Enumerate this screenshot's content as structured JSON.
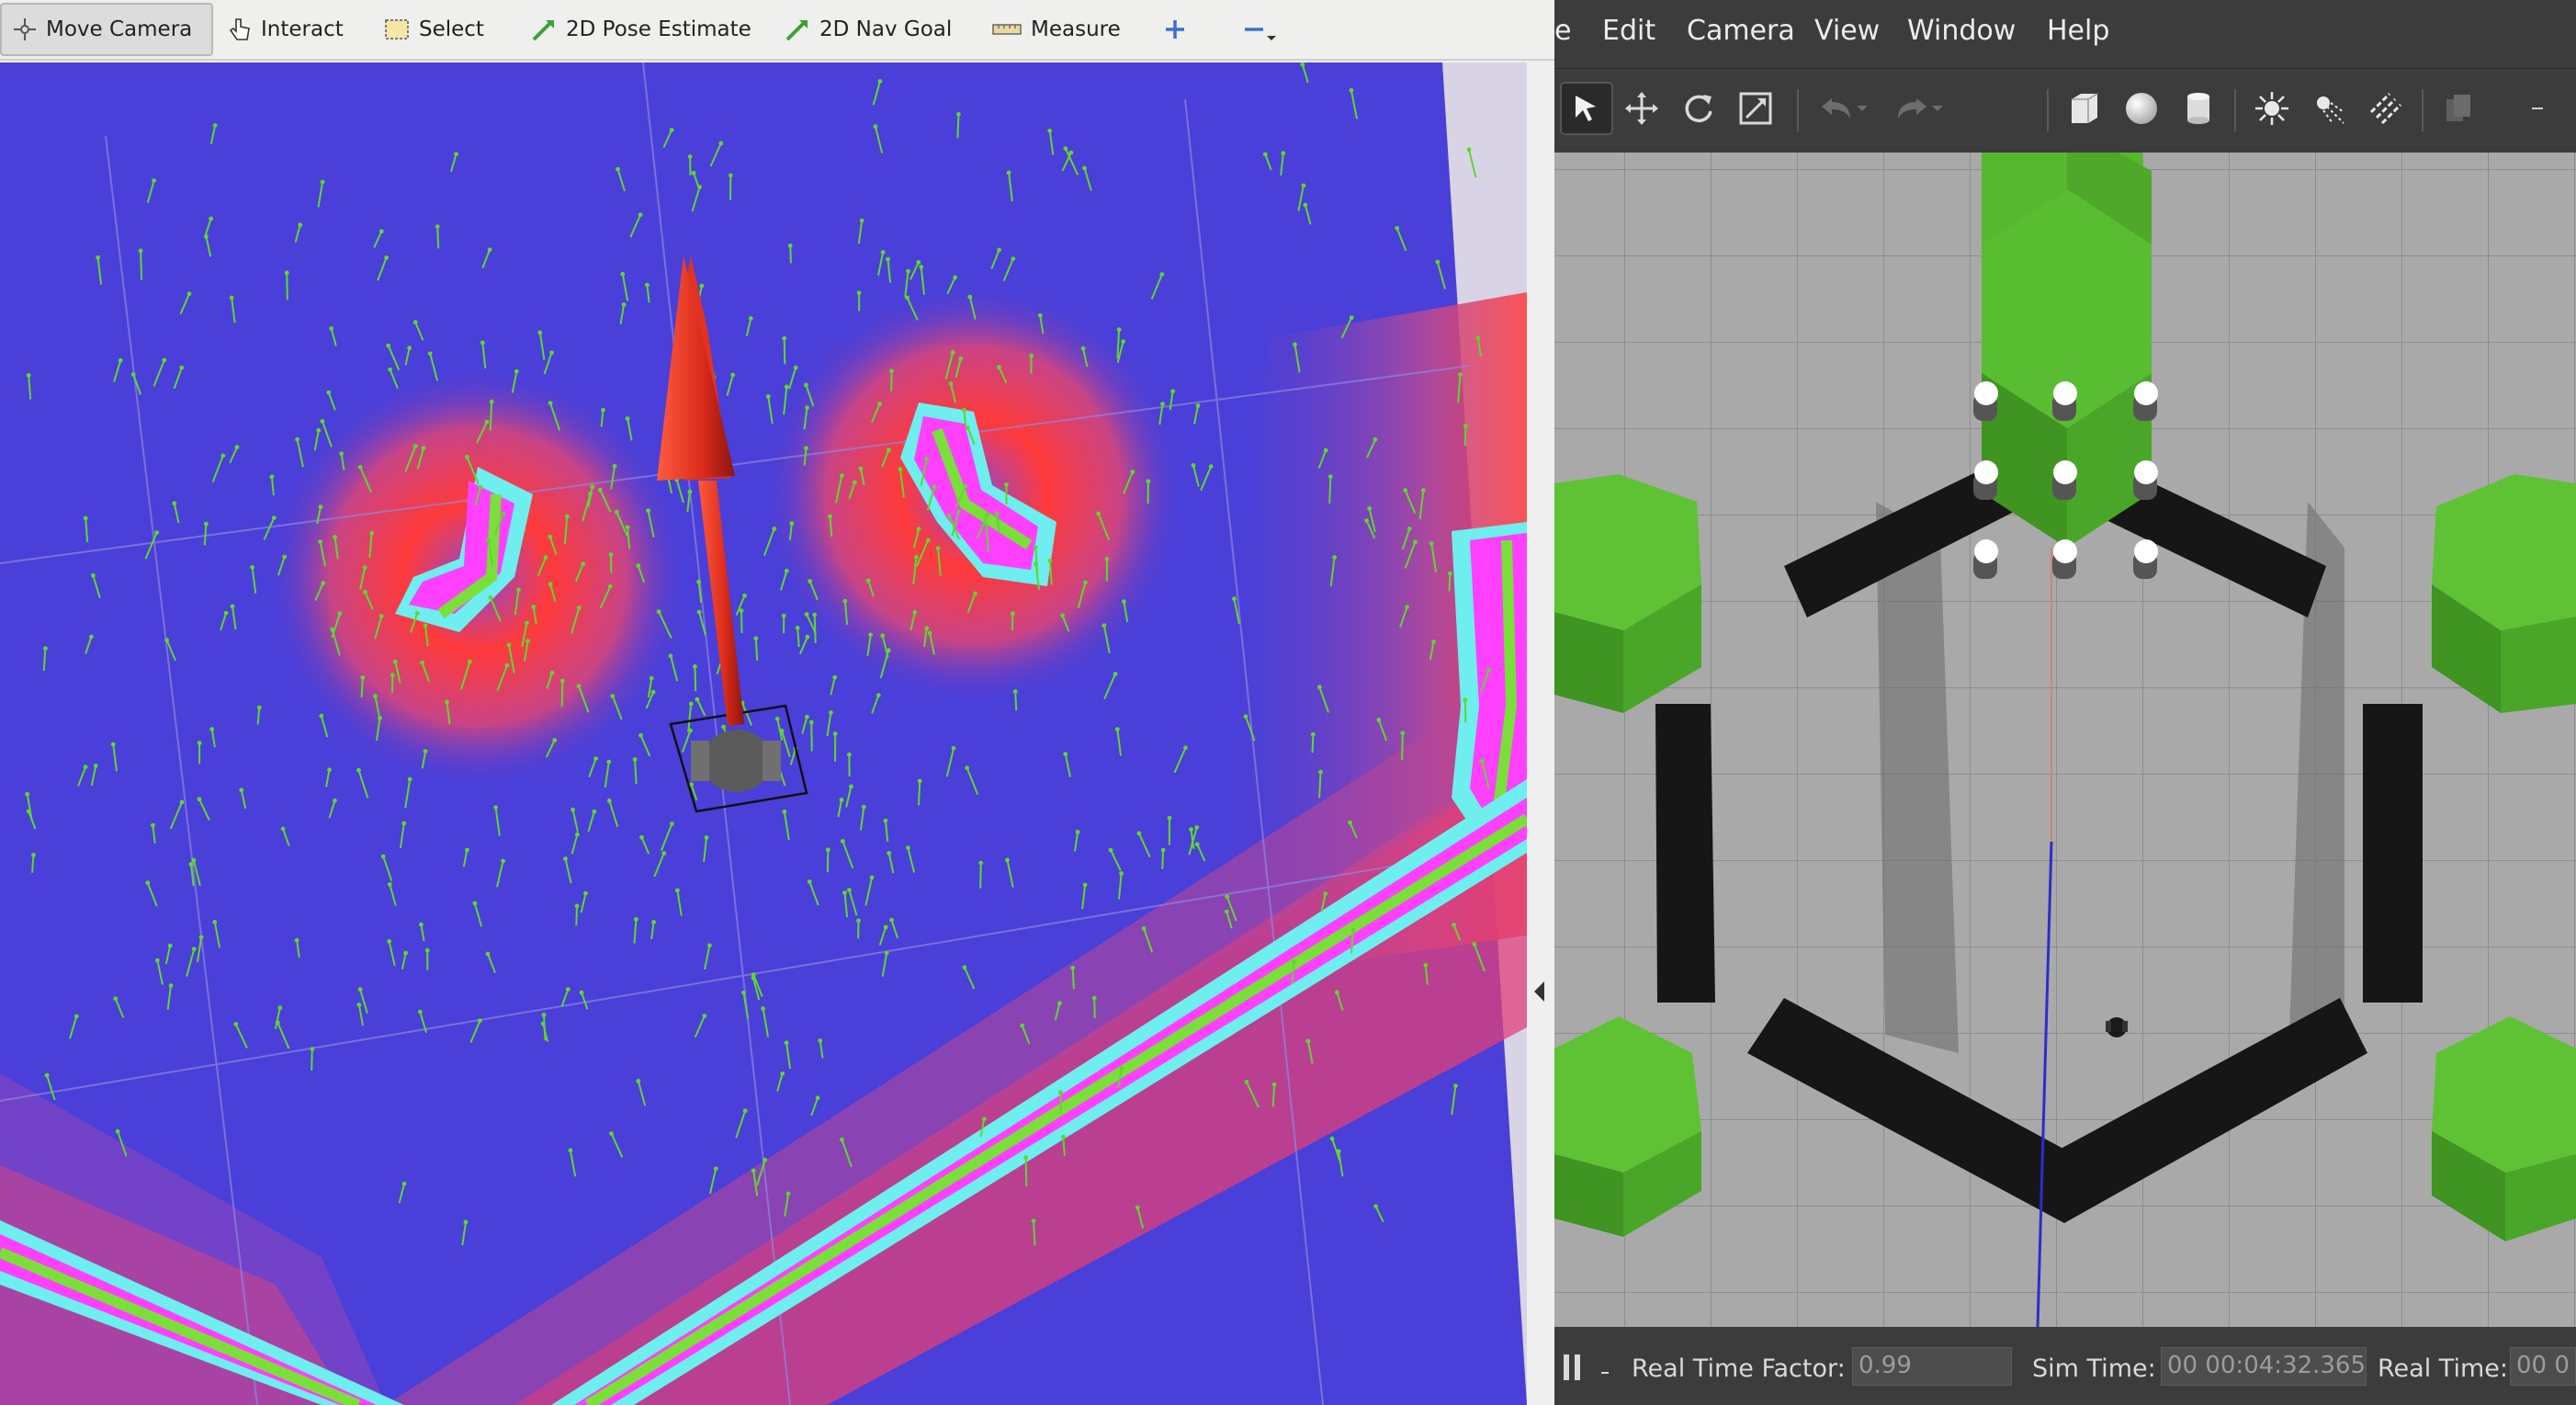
{
  "rviz": {
    "tools": [
      {
        "label": "Move Camera",
        "icon": "move-camera-icon"
      },
      {
        "label": "Interact",
        "icon": "hand-pointer-icon"
      },
      {
        "label": "Select",
        "icon": "select-box-icon"
      },
      {
        "label": "2D Pose Estimate",
        "icon": "pose-estimate-arrow-icon"
      },
      {
        "label": "2D Nav Goal",
        "icon": "nav-goal-arrow-icon"
      },
      {
        "label": "Measure",
        "icon": "ruler-icon"
      }
    ],
    "active_tool": "Move Camera",
    "extra_icons": [
      "add-tool-icon",
      "remove-tool-icon",
      "dropdown-caret-icon"
    ],
    "colors": {
      "costmap_low": "#4a3fd8",
      "costmap_mid": "#8b48c8",
      "costmap_high": "#e04a4a",
      "inflated": "#ff40ff",
      "lethal": "#6eeeee",
      "obstacle": "#7adf3a",
      "particles": "#5fd630",
      "goal_arrow": "#d92a1a"
    }
  },
  "gazebo": {
    "menus": [
      "e",
      "Edit",
      "Camera",
      "View",
      "Window",
      "Help"
    ],
    "toolbar_icons": [
      "select-arrow-icon",
      "translate-icon",
      "rotate-icon",
      "scale-icon",
      "undo-icon",
      "undo-dropdown-icon",
      "redo-icon",
      "redo-dropdown-icon",
      "box-shape-icon",
      "sphere-shape-icon",
      "cylinder-shape-icon",
      "point-light-icon",
      "spot-light-icon",
      "directional-light-icon",
      "copy-icon"
    ],
    "status": {
      "real_time_factor_label": "Real Time Factor:",
      "real_time_factor_value": "0.99",
      "sim_time_label": "Sim Time:",
      "sim_time_value": "00 00:04:32.365",
      "real_time_label": "Real Time:",
      "real_time_value": "00 0"
    },
    "colors": {
      "ground": "#a9a9a9",
      "grid": "#8f8f8f",
      "hexagon_green": "#5ec236",
      "walls": "#151515",
      "pillars": "#ffffff"
    }
  }
}
